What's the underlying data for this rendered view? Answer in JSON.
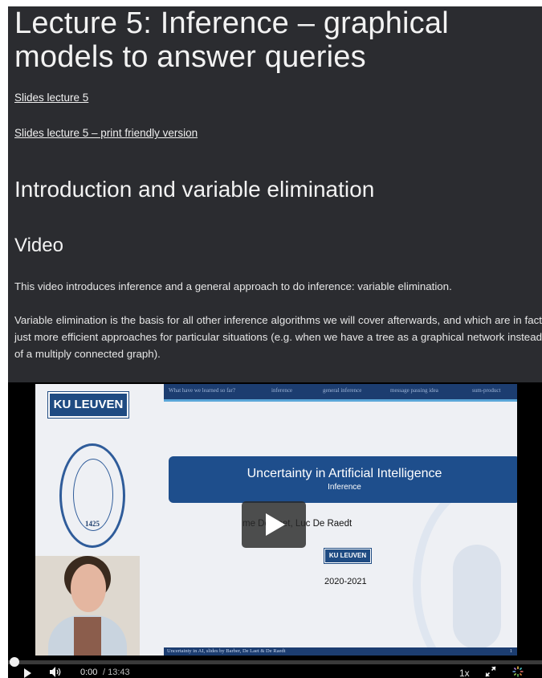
{
  "header": {
    "title_line1": "Lecture 5: Inference – graphical",
    "title_line2": "models to answer queries"
  },
  "links": {
    "slides": "Slides lecture 5",
    "slides_print": "Slides lecture 5 – print friendly version"
  },
  "section": {
    "heading": "Introduction and variable elimination",
    "subheading": "Video",
    "paragraph1": "This video introduces inference and a general approach to do inference: variable elimination.",
    "paragraph2": "Variable elimination is the basis for all other inference algorithms we will cover afterwards, and which are in fact just more efficient approaches for particular situations (e.g. when we have a tree as a graphical network instead of a multiply connected graph)."
  },
  "video": {
    "slide": {
      "logo": "KU LEUVEN",
      "seal_year": "1425",
      "topbar_items": [
        "What have we learned so far?",
        "inference",
        "general inference",
        "message passing idea",
        "sum-product"
      ],
      "title": "Uncertainty in Artificial Intelligence",
      "subtitle": "Inference",
      "authors": "me De Laet, Luc De Raedt",
      "small_logo": "KU LEUVEN",
      "year": "2020-2021",
      "footer": "Uncertainty in AI, slides by Barber, De Laet & De Raedt",
      "page_number": "1"
    },
    "controls": {
      "current_time": "0:00",
      "duration": "/ 13:43",
      "speed": "1x",
      "progress": 0
    }
  },
  "colors": {
    "page_bg": "#2b2c30",
    "slide_blue": "#1e4e8c",
    "text": "#ececec"
  }
}
